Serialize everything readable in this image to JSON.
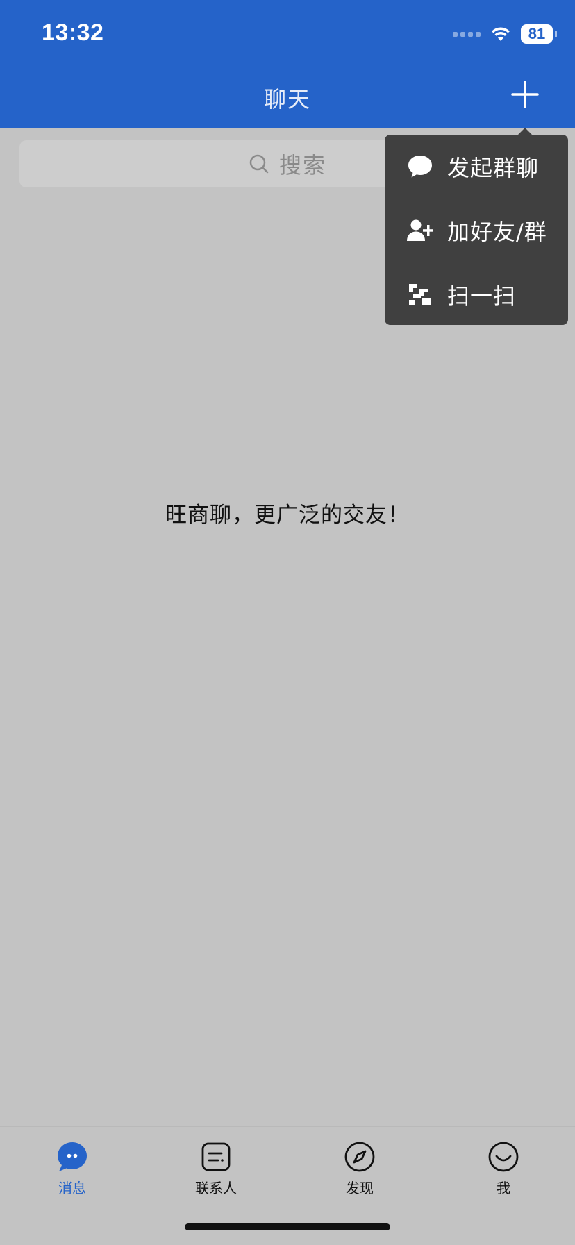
{
  "status_bar": {
    "time": "13:32",
    "battery": "81"
  },
  "nav": {
    "title": "聊天",
    "add_icon": "plus-icon"
  },
  "search": {
    "placeholder": "搜索",
    "icon": "search-icon"
  },
  "popup_menu": {
    "items": [
      {
        "label": "发起群聊",
        "icon": "chat-bubble-icon"
      },
      {
        "label": "加好友/群",
        "icon": "add-user-icon"
      },
      {
        "label": "扫一扫",
        "icon": "scan-icon"
      }
    ]
  },
  "empty_state": {
    "text": "旺商聊，更广泛的交友！"
  },
  "tabbar": {
    "tabs": [
      {
        "label": "消息",
        "icon": "message-icon",
        "active": true
      },
      {
        "label": "联系人",
        "icon": "contacts-icon",
        "active": false
      },
      {
        "label": "发现",
        "icon": "compass-icon",
        "active": false
      },
      {
        "label": "我",
        "icon": "smiley-icon",
        "active": false
      }
    ]
  },
  "colors": {
    "primary": "#2563c9",
    "background": "#c3c3c3",
    "popup": "#404040"
  }
}
